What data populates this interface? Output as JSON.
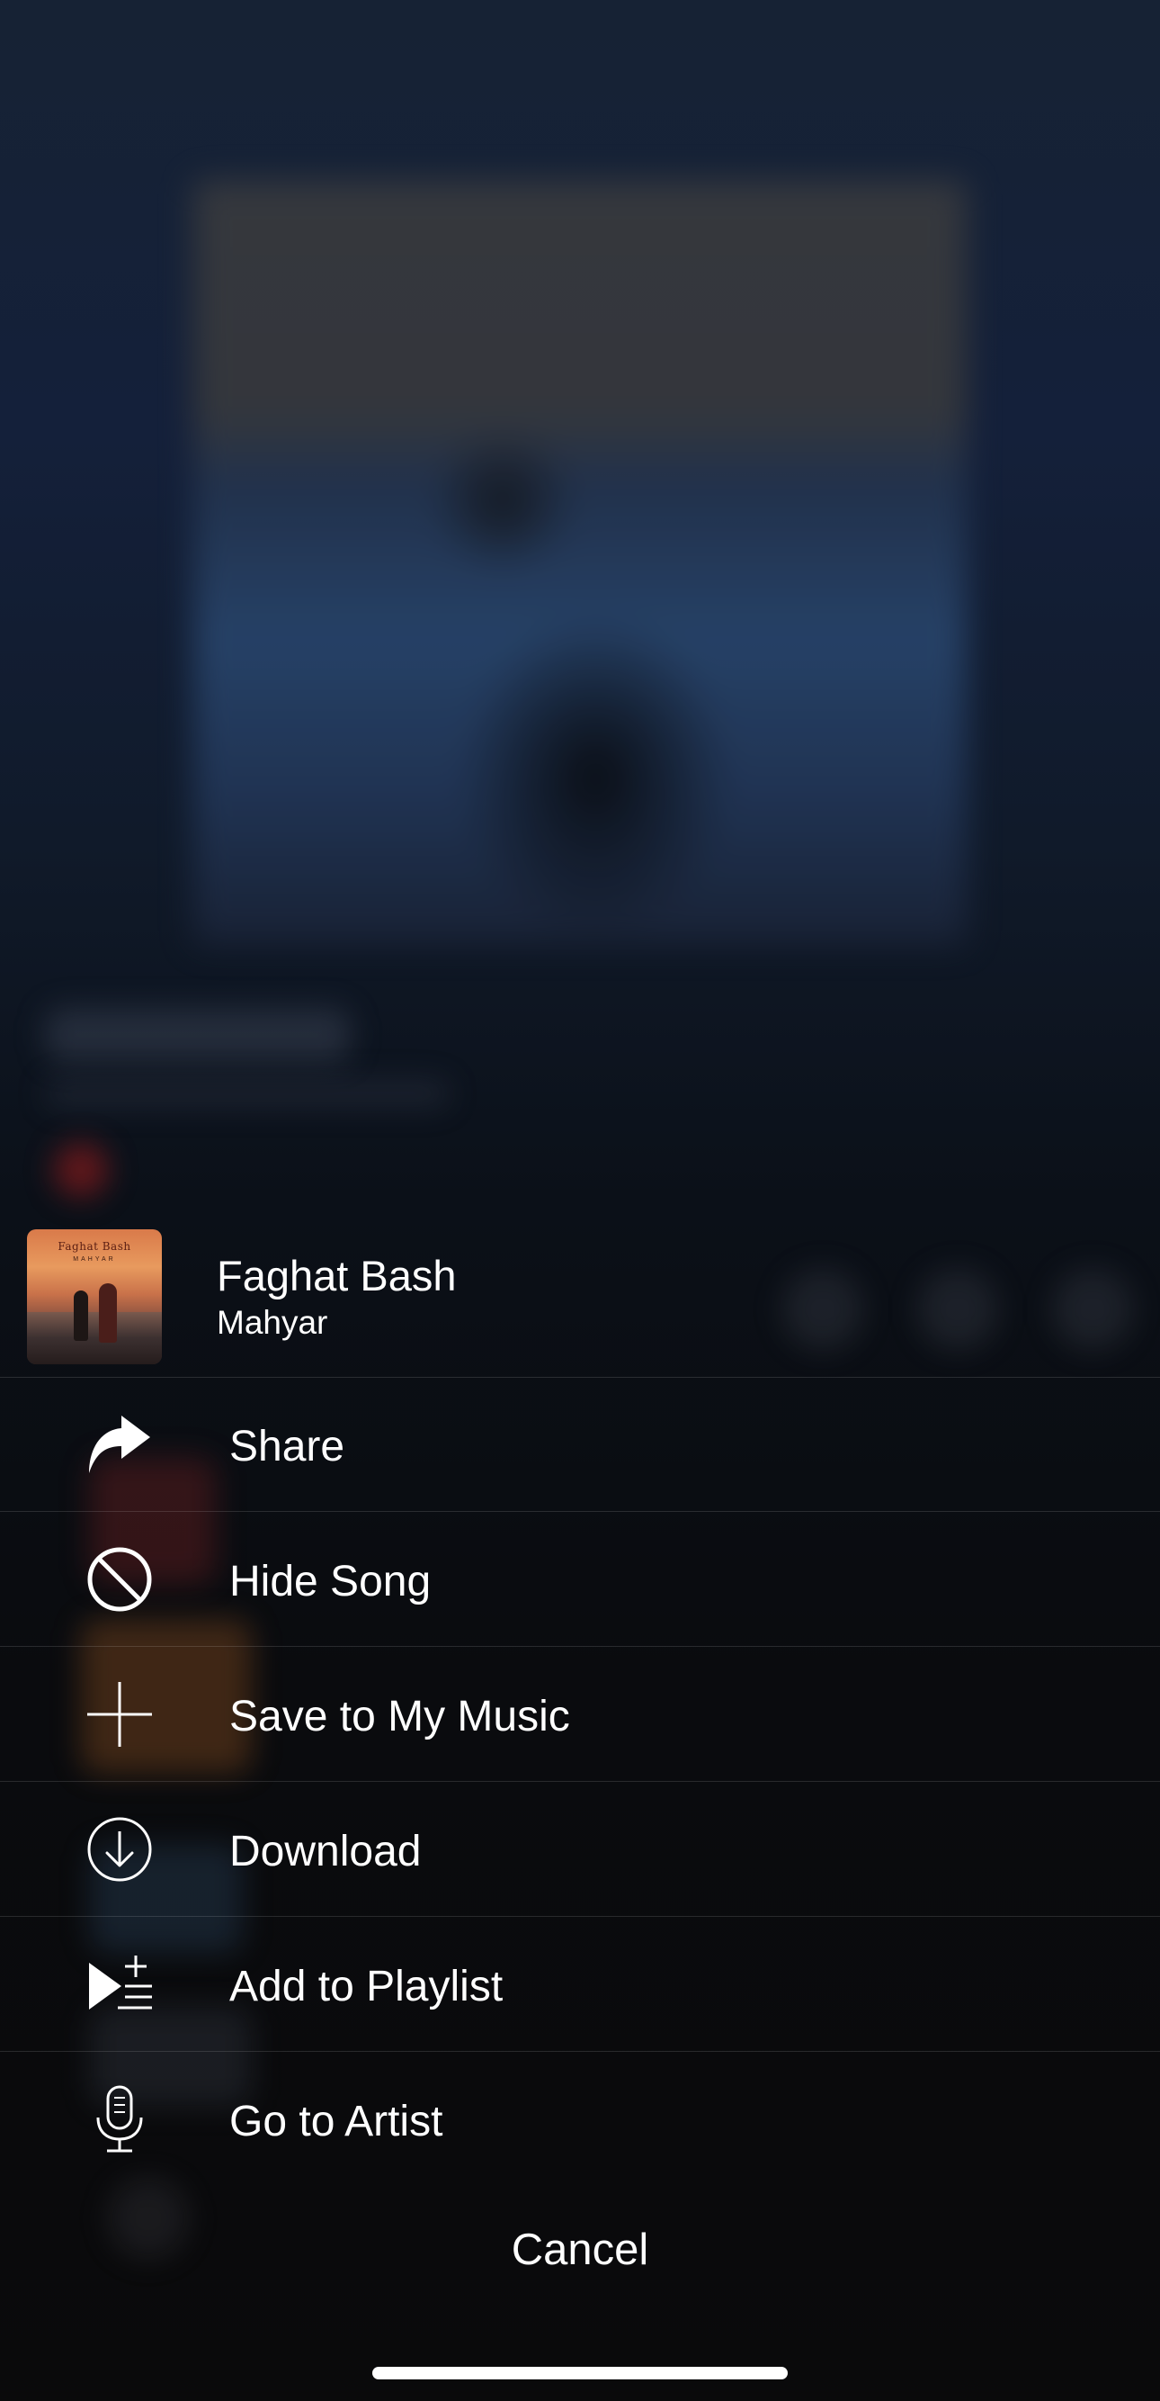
{
  "song": {
    "title": "Faghat Bash",
    "artist": "Mahyar",
    "artwork": {
      "title_text": "Faghat Bash",
      "subtitle_text": "MAHYAR"
    }
  },
  "actions": [
    {
      "label": "Share",
      "icon": "share-icon"
    },
    {
      "label": "Hide Song",
      "icon": "hide-icon"
    },
    {
      "label": "Save to My Music",
      "icon": "plus-icon"
    },
    {
      "label": "Download",
      "icon": "download-icon"
    },
    {
      "label": "Add to Playlist",
      "icon": "add-to-playlist-icon"
    },
    {
      "label": "Go to Artist",
      "icon": "microphone-icon"
    }
  ],
  "cancel_label": "Cancel",
  "colors": {
    "text": "#ffffff",
    "background_top": "#162234",
    "background_bottom": "#0a0a0b",
    "divider": "rgba(255,255,255,0.13)"
  }
}
